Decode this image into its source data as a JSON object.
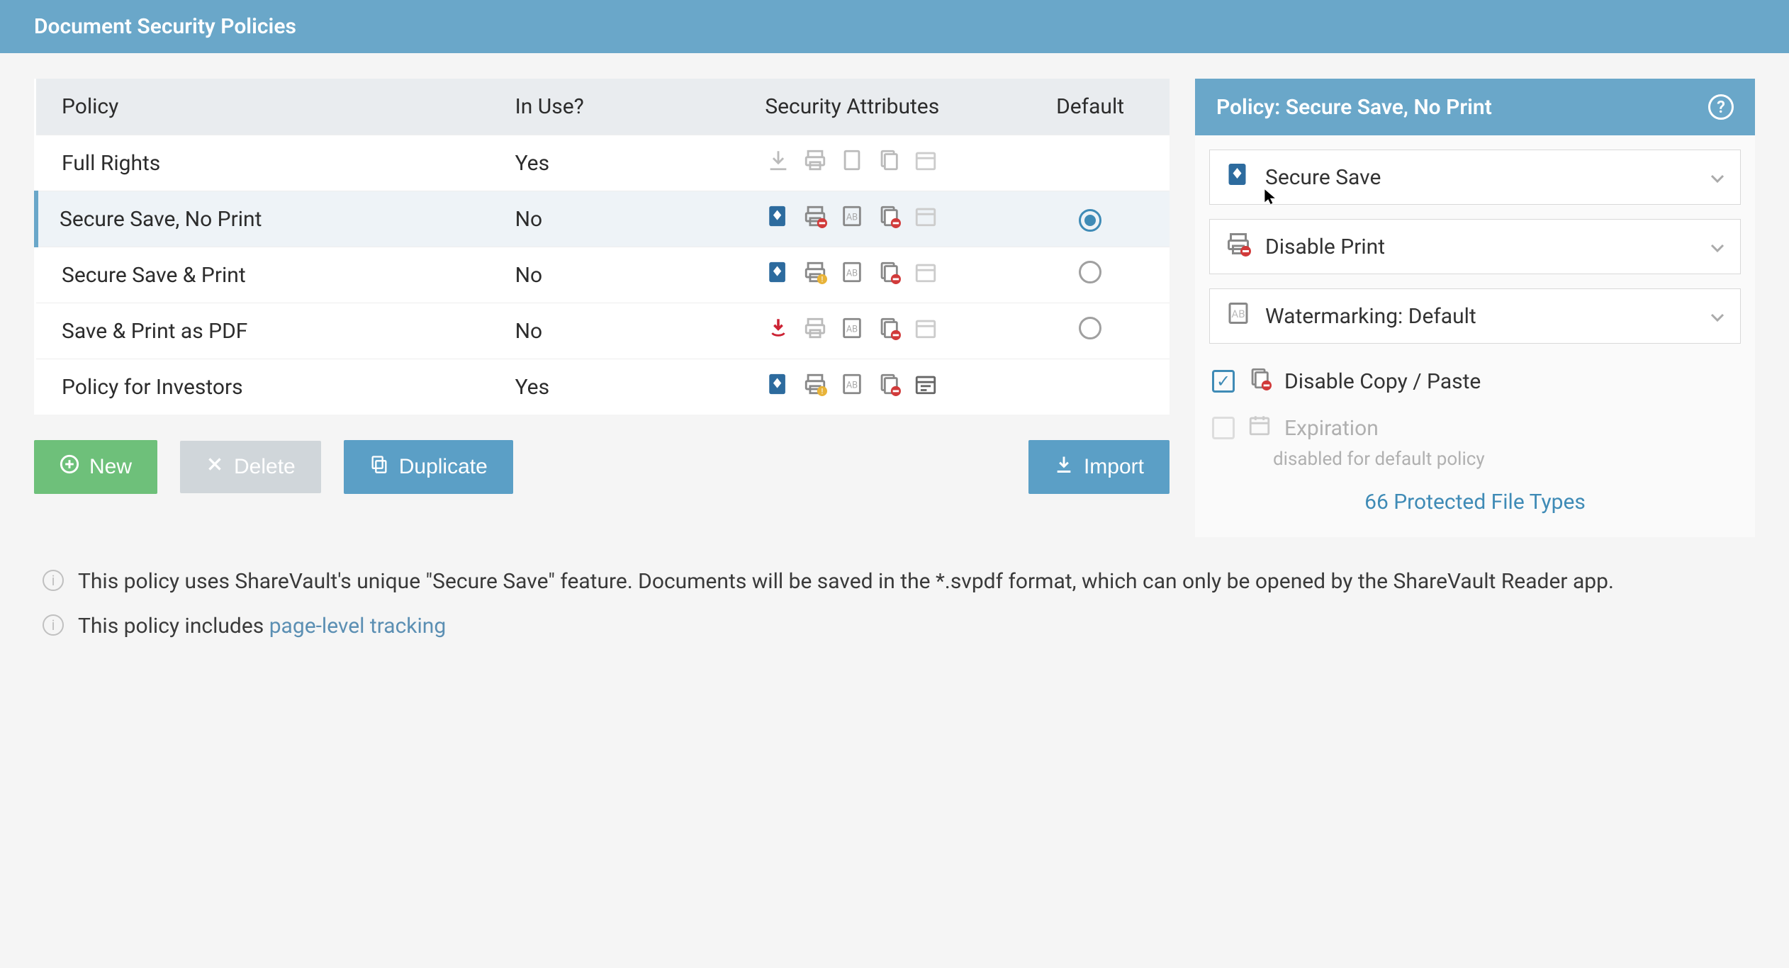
{
  "header": {
    "title": "Document Security Policies"
  },
  "table": {
    "headers": {
      "policy": "Policy",
      "inuse": "In Use?",
      "attr": "Security Attributes",
      "default": "Default"
    },
    "rows": [
      {
        "name": "Full Rights",
        "inuse": "Yes",
        "inuse_yes": true,
        "selected": false,
        "default_radio": "none",
        "icons": [
          "download-gray",
          "print-gray",
          "page-gray",
          "copy-gray",
          "calendar-gray"
        ]
      },
      {
        "name": "Secure Save, No Print",
        "inuse": "No",
        "inuse_yes": false,
        "selected": true,
        "default_radio": "filled",
        "icons": [
          "secure-save",
          "print-disabled",
          "watermark",
          "copy-disabled",
          "calendar-gray"
        ]
      },
      {
        "name": "Secure Save & Print",
        "inuse": "No",
        "inuse_yes": false,
        "selected": false,
        "default_radio": "empty",
        "icons": [
          "secure-save",
          "print-warn",
          "watermark",
          "copy-disabled",
          "calendar-gray"
        ]
      },
      {
        "name": "Save & Print as PDF",
        "inuse": "No",
        "inuse_yes": false,
        "selected": false,
        "default_radio": "empty",
        "icons": [
          "pdf-down",
          "print-gray",
          "watermark",
          "copy-disabled",
          "calendar-gray"
        ]
      },
      {
        "name": "Policy for Investors",
        "inuse": "Yes",
        "inuse_yes": true,
        "selected": false,
        "default_radio": "none",
        "icons": [
          "secure-save",
          "print-warn",
          "watermark",
          "copy-disabled",
          "calendar-active"
        ]
      }
    ]
  },
  "buttons": {
    "new": "New",
    "delete": "Delete",
    "duplicate": "Duplicate",
    "import": "Import"
  },
  "detail": {
    "title": "Policy: Secure Save, No Print",
    "settings": [
      {
        "icon": "secure-save",
        "label": "Secure Save"
      },
      {
        "icon": "print-disabled",
        "label": "Disable Print"
      },
      {
        "icon": "watermark",
        "label": "Watermarking: Default"
      }
    ],
    "copy_paste": {
      "checked": true,
      "label": "Disable Copy / Paste"
    },
    "expiration": {
      "checked": false,
      "label": "Expiration",
      "note": "disabled for default policy"
    },
    "protected_link": "66 Protected File Types"
  },
  "info": {
    "line1": "This policy uses ShareVault's unique \"Secure Save\" feature. Documents will be saved in the *.svpdf format, which can only be opened by the ShareVault Reader app.",
    "line2_pre": "This policy includes ",
    "line2_link": "page-level tracking"
  }
}
